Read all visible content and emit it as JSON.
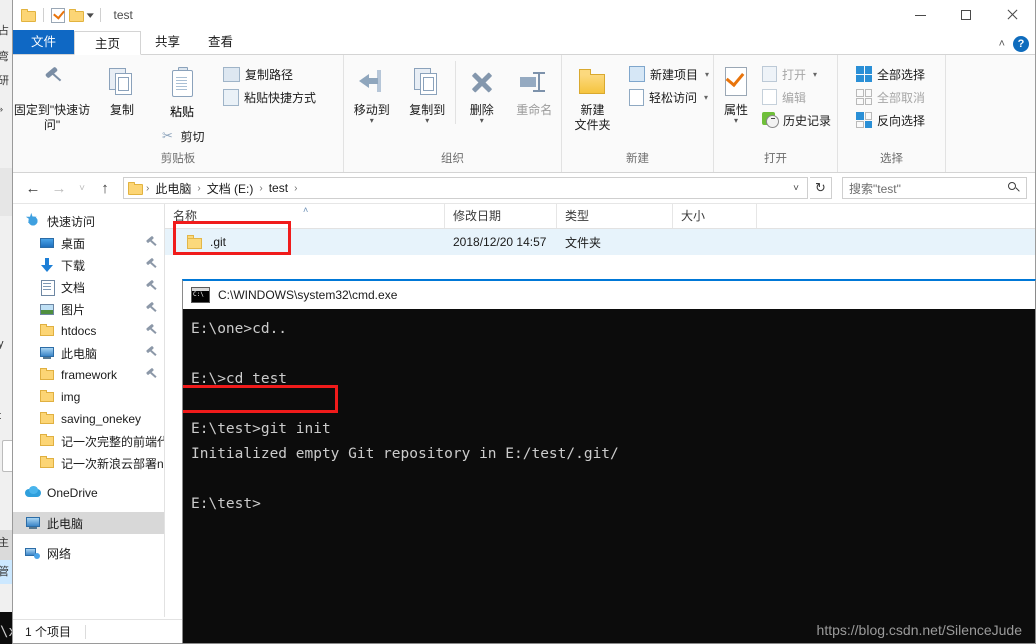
{
  "window": {
    "title": "test",
    "caption_buttons": {
      "minimize": "minimize-button",
      "maximize": "maximize-button",
      "close": "close-button"
    }
  },
  "quick_access": {
    "folder_icon": "folder-icon",
    "properties_icon": "properties-check-icon",
    "new_folder_icon": "folder-icon",
    "dropdown": "▾"
  },
  "tabs": [
    {
      "label": "文件",
      "name": "tab-file"
    },
    {
      "label": "主页",
      "name": "tab-home"
    },
    {
      "label": "共享",
      "name": "tab-share"
    },
    {
      "label": "查看",
      "name": "tab-view"
    }
  ],
  "tab_right": {
    "collapse": "˄",
    "help": "?"
  },
  "ribbon": {
    "groups": [
      {
        "label": "剪贴板",
        "big": [
          {
            "label": "固定到\"快速访问\"",
            "icon": "pin-icon"
          },
          {
            "label": "复制",
            "icon": "copy-icon"
          },
          {
            "label": "粘贴",
            "icon": "paste-icon"
          }
        ],
        "small": [
          {
            "label": "复制路径",
            "icon": "copy-path-icon"
          },
          {
            "label": "粘贴快捷方式",
            "icon": "paste-shortcut-icon"
          },
          {
            "label": "剪切",
            "icon": "scissors-icon"
          }
        ]
      },
      {
        "label": "组织",
        "big": [
          {
            "label": "移动到",
            "icon": "move-to-icon",
            "caret": "▾"
          },
          {
            "label": "复制到",
            "icon": "copy-to-icon",
            "caret": "▾"
          },
          {
            "label": "删除",
            "icon": "delete-x-icon",
            "caret": "▾"
          },
          {
            "label": "重命名",
            "icon": "rename-icon"
          }
        ]
      },
      {
        "label": "新建",
        "big": [
          {
            "label": "新建\n文件夹",
            "icon": "new-folder-icon"
          }
        ],
        "small": [
          {
            "label": "新建项目",
            "icon": "new-item-icon",
            "caret": "▾"
          },
          {
            "label": "轻松访问",
            "icon": "easy-access-icon",
            "caret": "▾"
          }
        ]
      },
      {
        "label": "打开",
        "big": [
          {
            "label": "属性",
            "icon": "properties-icon",
            "caret": "▾"
          }
        ],
        "small": [
          {
            "label": "打开",
            "icon": "open-icon",
            "caret": "▾"
          },
          {
            "label": "编辑",
            "icon": "edit-icon"
          },
          {
            "label": "历史记录",
            "icon": "history-icon"
          }
        ]
      },
      {
        "label": "选择",
        "small": [
          {
            "label": "全部选择",
            "icon": "select-all-icon"
          },
          {
            "label": "全部取消",
            "icon": "select-none-icon"
          },
          {
            "label": "反向选择",
            "icon": "invert-selection-icon"
          }
        ]
      }
    ]
  },
  "navbar": {
    "back": "←",
    "forward": "→",
    "recent": "˅",
    "up": "↑",
    "breadcrumb": [
      "此电脑",
      "文档 (E:)",
      "test"
    ],
    "separator": "›",
    "dropdown": "˅",
    "refresh": "↻",
    "search_placeholder": "搜索\"test\""
  },
  "navpane": [
    {
      "label": "快速访问",
      "icon": "star-icon",
      "indent": false,
      "pinned": false,
      "selected": false
    },
    {
      "label": "桌面",
      "icon": "desktop-icon",
      "indent": true,
      "pinned": true,
      "selected": false
    },
    {
      "label": "下载",
      "icon": "downloads-icon",
      "indent": true,
      "pinned": true,
      "selected": false
    },
    {
      "label": "文档",
      "icon": "documents-icon",
      "indent": true,
      "pinned": true,
      "selected": false
    },
    {
      "label": "图片",
      "icon": "pictures-icon",
      "indent": true,
      "pinned": true,
      "selected": false
    },
    {
      "label": "htdocs",
      "icon": "folder-icon",
      "indent": true,
      "pinned": true,
      "selected": false
    },
    {
      "label": "此电脑",
      "icon": "this-pc-icon",
      "indent": true,
      "pinned": true,
      "selected": false
    },
    {
      "label": "framework",
      "icon": "folder-icon",
      "indent": true,
      "pinned": true,
      "selected": false
    },
    {
      "label": "img",
      "icon": "folder-icon",
      "indent": true,
      "pinned": false,
      "selected": false
    },
    {
      "label": "saving_onekey",
      "icon": "folder-icon",
      "indent": true,
      "pinned": false,
      "selected": false
    },
    {
      "label": "记一次完整的前端代",
      "icon": "folder-icon",
      "indent": true,
      "pinned": false,
      "selected": false
    },
    {
      "label": "记一次新浪云部署n",
      "icon": "folder-icon",
      "indent": true,
      "pinned": false,
      "selected": false
    },
    {
      "label": "OneDrive",
      "icon": "onedrive-icon",
      "indent": false,
      "pinned": false,
      "selected": false
    },
    {
      "label": "此电脑",
      "icon": "this-pc-icon",
      "indent": false,
      "pinned": false,
      "selected": true
    },
    {
      "label": "网络",
      "icon": "network-icon",
      "indent": false,
      "pinned": false,
      "selected": false
    }
  ],
  "filelist": {
    "columns": [
      "名称",
      "修改日期",
      "类型",
      "大小"
    ],
    "sort_indicator": "˄",
    "rows": [
      {
        "name": ".git",
        "modified": "2018/12/20 14:57",
        "type": "文件夹",
        "size": "",
        "icon": "folder-icon",
        "selected": true
      }
    ]
  },
  "statusbar": {
    "count": "1 个项目"
  },
  "cmd": {
    "title": "C:\\WINDOWS\\system32\\cmd.exe",
    "icon": "cmd-icon",
    "lines": [
      "E:\\one>cd..",
      "",
      "E:\\>cd test",
      "",
      "E:\\test>git init",
      "Initialized empty Git repository in E:/test/.git/",
      "",
      "E:\\test>"
    ]
  },
  "background": {
    "left_sliver_texts": [
      "占",
      "弯",
      "研",
      "»",
      "y",
      "t",
      "主",
      "管"
    ],
    "bottom_terminal_text": "\\xampp\\htdocs\\"
  },
  "watermark": "https://blog.csdn.net/SilenceJude",
  "colors": {
    "accent": "#0f68c4",
    "selection": "#e7f3fb",
    "annotation_red": "#f01b1b",
    "terminal_bg": "#0c0c0c",
    "terminal_fg": "#cccccc"
  }
}
